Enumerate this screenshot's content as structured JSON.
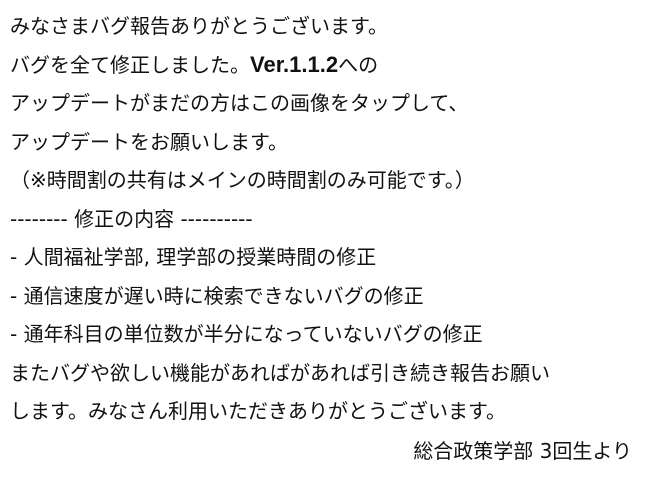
{
  "notice": {
    "line1": "みなさまバグ報告ありがとうございます。",
    "line2_before": "バグを全て修正しました。",
    "line2_version": "Ver.1.1.2",
    "line2_after": "への",
    "line3": "アップデートがまだの方はこの画像をタップして、",
    "line4": "アップデートをお願いします。",
    "line5": "（※時間割の共有はメインの時間割のみ可能です。）",
    "line6": "--------  修正の内容 ----------",
    "fixes": [
      "- 人間福祉学部, 理学部の授業時間の修正",
      "- 通信速度が遅い時に検索できないバグの修正",
      "- 通年科目の単位数が半分になっていないバグの修正"
    ],
    "line10": "またバグや欲しい機能があればがあれば引き続き報告お願い",
    "line11": "します。みなさん利用いただきありがとうございます。",
    "signature": "総合政策学部 3回生より"
  }
}
